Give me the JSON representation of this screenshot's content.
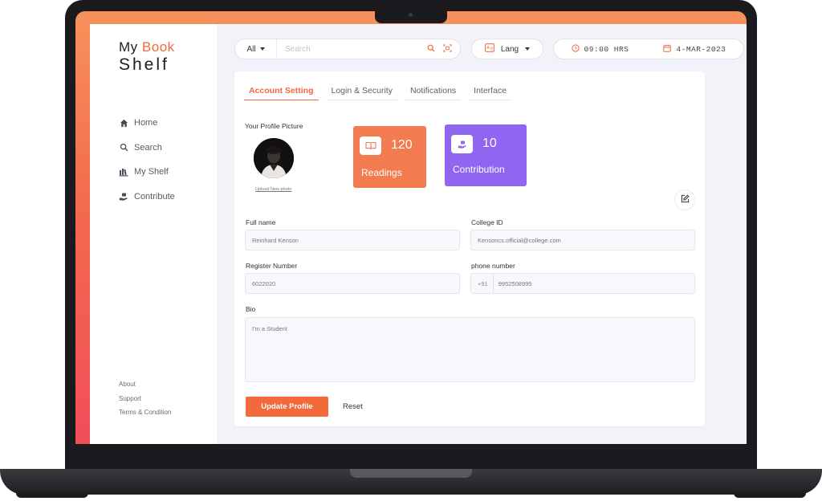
{
  "brand": {
    "line1_prefix": "My",
    "line1_accent": "Book",
    "line2": "Shelf"
  },
  "sidebar": {
    "items": [
      {
        "label": "Home",
        "icon": "home-icon"
      },
      {
        "label": "Search",
        "icon": "search-icon"
      },
      {
        "label": "My Shelf",
        "icon": "shelf-icon"
      },
      {
        "label": "Contribute",
        "icon": "contribute-icon"
      }
    ],
    "footer_links": [
      "About",
      "Support",
      "Terms & Condition"
    ]
  },
  "topbar": {
    "search_filter": "All",
    "search_placeholder": "Search",
    "lang_label": "Lang",
    "time": "09:00 HRS",
    "date": "4-MAR-2023"
  },
  "tabs": [
    {
      "label": "Account Setting",
      "active": true
    },
    {
      "label": "Login & Security",
      "active": false
    },
    {
      "label": "Notifications",
      "active": false
    },
    {
      "label": "Interface",
      "active": false
    }
  ],
  "profile": {
    "picture_label": "Your Profile  Picture",
    "upload_label": "Upload New photo"
  },
  "stats": {
    "readings": {
      "value": "120",
      "label": "Readings"
    },
    "contribution": {
      "value": "10",
      "label": "Contribution"
    }
  },
  "form": {
    "full_name": {
      "label": "Full name",
      "value": "Reinhard Kenson"
    },
    "college_id": {
      "label": "College  ID",
      "value": "Kensoncs.official@college.com"
    },
    "register_number": {
      "label": "Register Number",
      "value": "6022020"
    },
    "phone": {
      "label": "phone number",
      "prefix": "+91",
      "value": "9952508995"
    },
    "bio": {
      "label": "Bio",
      "value": "I'm a Student"
    }
  },
  "actions": {
    "update_label": "Update Profile",
    "reset_label": "Reset"
  },
  "colors": {
    "accent": "#f06a3e",
    "purple": "#9065f0",
    "orange_card": "#f27b50"
  }
}
